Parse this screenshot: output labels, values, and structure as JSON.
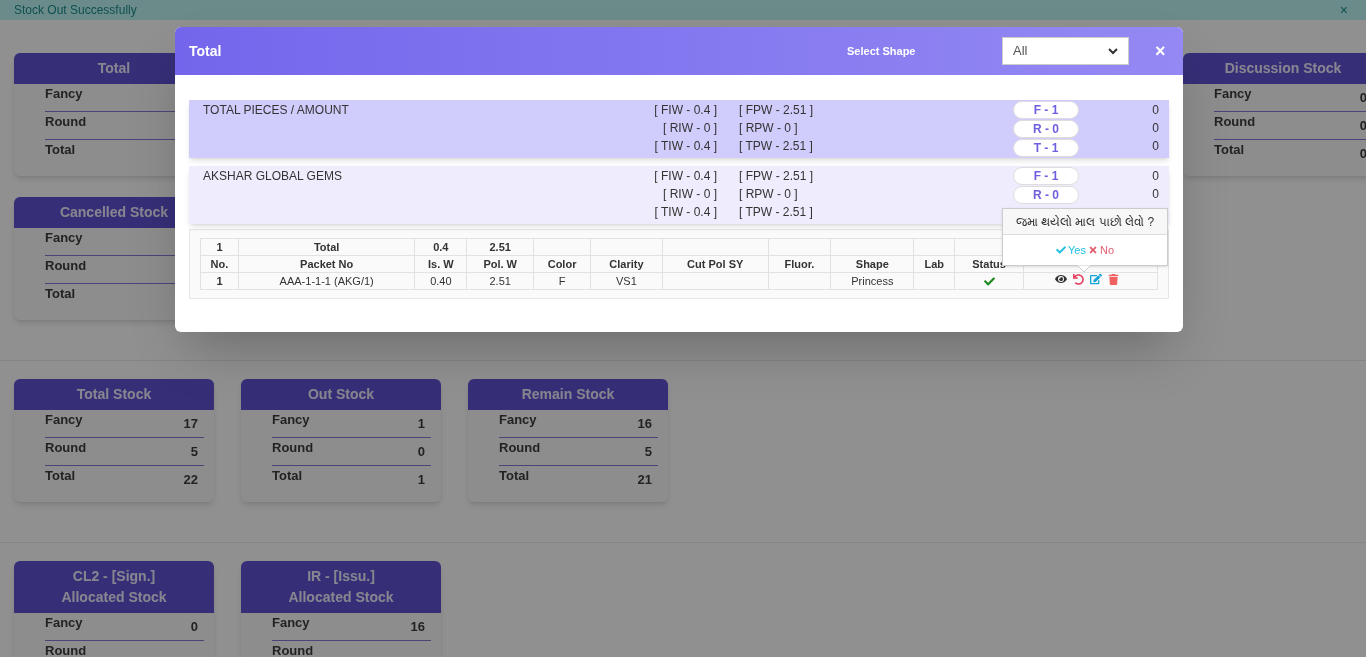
{
  "banner": {
    "message": "Stock Out Successfully",
    "close": "×"
  },
  "sections": [
    {
      "rows": [
        {
          "cards": [
            {
              "title": "Total",
              "lines": [
                {
                  "label": "Fancy"
                },
                {
                  "label": "Round"
                },
                {
                  "label": "Total"
                }
              ]
            },
            {
              "title": "Discussion Stock",
              "lines": [
                {
                  "label": "Fancy",
                  "value": "0"
                },
                {
                  "label": "Round",
                  "value": "0"
                },
                {
                  "label": "Total",
                  "value": "0"
                }
              ]
            }
          ]
        },
        {
          "cards": [
            {
              "title": "Cancelled Stock",
              "lines": [
                {
                  "label": "Fancy"
                },
                {
                  "label": "Round"
                },
                {
                  "label": "Total"
                }
              ]
            }
          ]
        }
      ]
    },
    {
      "rows": [
        {
          "cards": [
            {
              "title": "Total Stock",
              "lines": [
                {
                  "label": "Fancy",
                  "value": "17"
                },
                {
                  "label": "Round",
                  "value": "5"
                },
                {
                  "label": "Total",
                  "value": "22"
                }
              ]
            },
            {
              "title": "Out Stock",
              "lines": [
                {
                  "label": "Fancy",
                  "value": "1"
                },
                {
                  "label": "Round",
                  "value": "0"
                },
                {
                  "label": "Total",
                  "value": "1"
                }
              ]
            },
            {
              "title": "Remain Stock",
              "lines": [
                {
                  "label": "Fancy",
                  "value": "16"
                },
                {
                  "label": "Round",
                  "value": "5"
                },
                {
                  "label": "Total",
                  "value": "21"
                }
              ]
            }
          ]
        }
      ]
    },
    {
      "rows": [
        {
          "cards": [
            {
              "title": "CL2 - [Sign.]",
              "subtitle": "Allocated Stock",
              "lines": [
                {
                  "label": "Fancy",
                  "value": "0"
                },
                {
                  "label": "Round"
                }
              ]
            },
            {
              "title": "IR - [Issu.]",
              "subtitle": "Allocated Stock",
              "lines": [
                {
                  "label": "Fancy",
                  "value": "16"
                },
                {
                  "label": "Round"
                }
              ]
            }
          ]
        }
      ]
    }
  ],
  "modal": {
    "title": "Total",
    "shape_label": "Select Shape",
    "shape_value": "All",
    "close": "×",
    "groups": [
      {
        "kind": "summary",
        "name": "TOTAL PIECES / AMOUNT",
        "weights": [
          [
            "[ FIW - 0.4 ]",
            "[ FPW - 2.51 ]"
          ],
          [
            "[ RIW - 0 ]",
            "[ RPW - 0 ]"
          ],
          [
            "[ TIW - 0.4 ]",
            "[ TPW - 2.51 ]"
          ]
        ],
        "pills": [
          "F - 1",
          "R - 0",
          "T - 1"
        ],
        "amounts": [
          "0",
          "0",
          "0"
        ]
      },
      {
        "kind": "party",
        "name": "AKSHAR GLOBAL GEMS",
        "weights": [
          [
            "[ FIW - 0.4 ]",
            "[ FPW - 2.51 ]"
          ],
          [
            "[ RIW - 0 ]",
            "[ RPW - 0 ]"
          ],
          [
            "[ TIW - 0.4 ]",
            "[ TPW - 2.51 ]"
          ]
        ],
        "pills": [
          "F - 1",
          "R - 0"
        ],
        "amounts": [
          "0",
          "0"
        ]
      }
    ],
    "table": {
      "totals": [
        "1",
        "Total",
        "0.4",
        "2.51"
      ],
      "columns": [
        "No.",
        "Packet No",
        "Is. W",
        "Pol. W",
        "Color",
        "Clarity",
        "Cut Pol SY",
        "Fluor.",
        "Shape",
        "Lab",
        "Status"
      ],
      "rows": [
        {
          "cells": [
            "1",
            "AAA-1-1-1 (AKG/1)",
            "0.40",
            "2.51",
            "F",
            "VS1",
            "",
            "",
            "Princess",
            ""
          ],
          "status_ok": true
        }
      ]
    },
    "popover": {
      "question": "જમા થયેલો માલ પાછો લેવો ?",
      "yes": "Yes",
      "no": "No"
    }
  }
}
